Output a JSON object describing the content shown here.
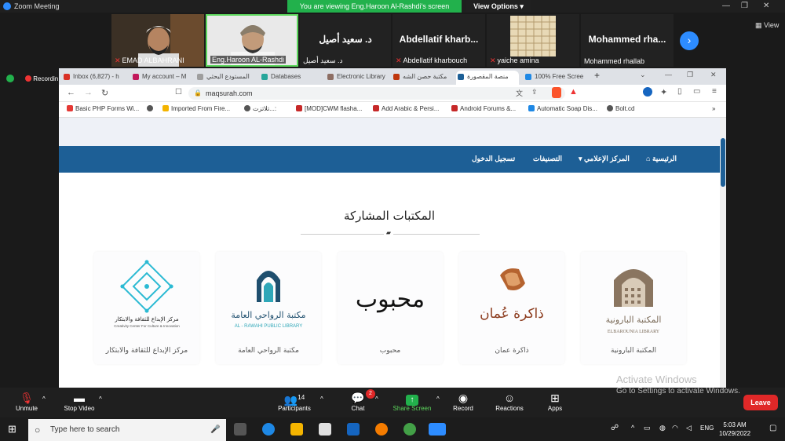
{
  "zoom": {
    "title": "Zoom Meeting",
    "share_banner": "You are viewing Eng.Haroon Al-Rashdi's screen",
    "view_options": "View Options",
    "view_label": "View",
    "participants": [
      {
        "name": "EMAD ALBAHRANI",
        "muted": true
      },
      {
        "name": "Eng.Haroon AL-Rashdi",
        "muted": false
      },
      {
        "big": "د. سعيد أصيل",
        "name": "د. سعيد أصيل",
        "muted": false
      },
      {
        "big": "Abdellatif kharb...",
        "name": "Abdellatif kharbouch",
        "muted": true
      },
      {
        "name": "yaiche amina",
        "muted": true
      },
      {
        "big": "Mohammed rha...",
        "name": "Mohammed rhallab",
        "muted": false
      }
    ],
    "recording_label": "Recording",
    "controls": {
      "unmute": "Unmute",
      "stop_video": "Stop Video",
      "participants": "Participants",
      "participants_count": "14",
      "chat": "Chat",
      "chat_badge": "2",
      "share_screen": "Share Screen",
      "record": "Record",
      "reactions": "Reactions",
      "apps": "Apps",
      "leave": "Leave"
    },
    "activate_title": "Activate Windows",
    "activate_sub": "Go to Settings to activate Windows."
  },
  "browser": {
    "tabs": [
      "Inbox (6,827) - h",
      "My account – M",
      "المستودع البحثي",
      "Databases",
      "Electronic Library",
      "مكتبة حصن الشه",
      "منصة المقصورة",
      "100% Free Scree"
    ],
    "url": "maqsurah.com",
    "bookmarks": [
      "Basic PHP Forms Wi...",
      "Imported From Fire...",
      "تلاتزت...:",
      "[MOD]CWM flasha...",
      "Add Arabic & Persi...",
      "Android Forums &...",
      "Automatic Soap Dis...",
      "Bolt.cd"
    ]
  },
  "site": {
    "nav": {
      "home": "الرئيسية",
      "media": "المركز الإعلامي",
      "categories": "التصنيفات",
      "login": "تسجيل الدخول"
    },
    "section_title": "المكتبات المشاركة",
    "libraries": [
      {
        "caption": "المكتبة البارونية",
        "logo_ar": "المكتبة البارونية",
        "logo_en": "ELBAROUNIA LIBRARY"
      },
      {
        "caption": "ذاكرة عمان",
        "logo_ar": "ذاكرة عُمان"
      },
      {
        "caption": "محبوب",
        "logo_ar": "محبوب"
      },
      {
        "caption": "مكتبة الرواحي العامة",
        "logo_ar": "مكتبة الرواحي العامة",
        "logo_en": "AL - RAWAHI PUBLIC LIBRARY"
      },
      {
        "caption": "مركز الإبداع للثقافة والابتكار",
        "logo_ar": "مركز الإبداع للثقافة والابتكار",
        "logo_en": "Creativity Center For Culture & Innovation"
      }
    ]
  },
  "taskbar": {
    "search_placeholder": "Type here to search",
    "language": "ENG",
    "time": "5:03 AM",
    "date": "10/29/2022"
  }
}
